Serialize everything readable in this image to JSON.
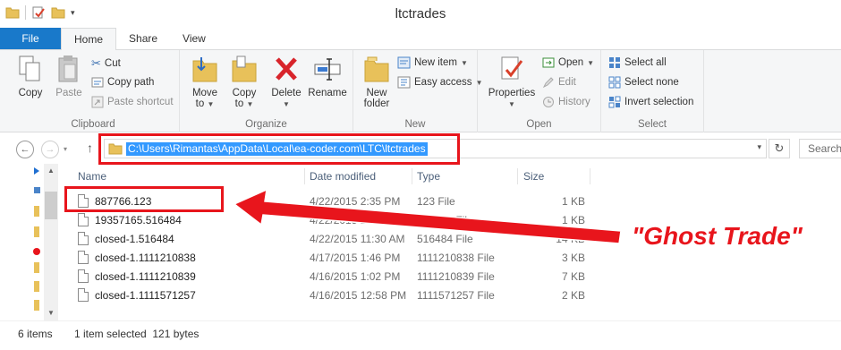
{
  "window": {
    "title": "ltctrades"
  },
  "ribbon_tabs": [
    "File",
    "Home",
    "Share",
    "View"
  ],
  "clipboard": {
    "label": "Clipboard",
    "copy": "Copy",
    "paste": "Paste",
    "cut": "Cut",
    "copy_path": "Copy path",
    "paste_shortcut": "Paste shortcut"
  },
  "organize": {
    "label": "Organize",
    "move_to": [
      "Move",
      "to"
    ],
    "copy_to": [
      "Copy",
      "to"
    ],
    "delete": "Delete",
    "rename": "Rename"
  },
  "new_group": {
    "label": "New",
    "new_folder": [
      "New",
      "folder"
    ],
    "new_item": "New item",
    "easy_access": "Easy access"
  },
  "open_group": {
    "label": "Open",
    "properties": "Properties",
    "open": "Open",
    "edit": "Edit",
    "history": "History"
  },
  "select_group": {
    "label": "Select",
    "select_all": "Select all",
    "select_none": "Select none",
    "invert_selection": "Invert selection"
  },
  "address": {
    "path": "C:\\Users\\Rimantas\\AppData\\Local\\ea-coder.com\\LTC\\ltctrades"
  },
  "search": {
    "placeholder": "Search"
  },
  "columns": {
    "name": "Name",
    "date": "Date modified",
    "type": "Type",
    "size": "Size"
  },
  "files": [
    {
      "name": "887766.123",
      "date": "4/22/2015 2:35 PM",
      "type": "123 File",
      "size": "1 KB"
    },
    {
      "name": "19357165.516484",
      "date": "4/22/2015 2:35 PM",
      "type": "516484 File",
      "size": "1 KB"
    },
    {
      "name": "closed-1.516484",
      "date": "4/22/2015 11:30 AM",
      "type": "516484 File",
      "size": "14 KB"
    },
    {
      "name": "closed-1.1111210838",
      "date": "4/17/2015 1:46 PM",
      "type": "1111210838 File",
      "size": "3 KB"
    },
    {
      "name": "closed-1.1111210839",
      "date": "4/16/2015 1:02 PM",
      "type": "1111210839 File",
      "size": "7 KB"
    },
    {
      "name": "closed-1.1111571257",
      "date": "4/16/2015 12:58 PM",
      "type": "1111571257 File",
      "size": "2 KB"
    }
  ],
  "status": {
    "items": "6 items",
    "selection": "1 item selected  121 bytes"
  },
  "annotation": {
    "text": "\"Ghost Trade\"",
    "color": "#e8151c"
  },
  "colors": {
    "file_tab": "#1979ca",
    "address_highlight": "#3399ff"
  }
}
